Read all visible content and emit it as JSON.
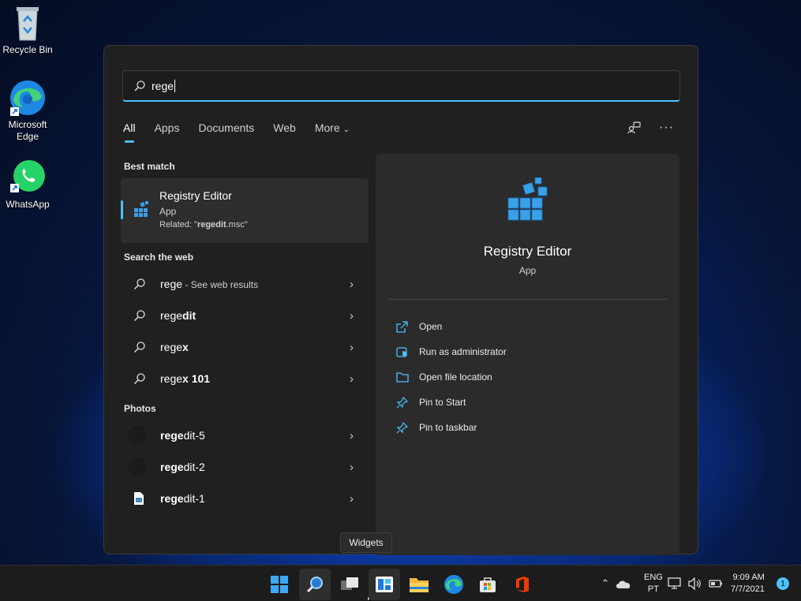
{
  "desktop": {
    "icons": [
      {
        "label": "Recycle Bin"
      },
      {
        "label": "Microsoft Edge"
      },
      {
        "label": "WhatsApp"
      }
    ]
  },
  "search": {
    "query": "rege",
    "tabs": [
      "All",
      "Apps",
      "Documents",
      "Web",
      "More"
    ],
    "active_tab": "All",
    "best_match": {
      "heading": "Best match",
      "title": "Registry Editor",
      "subtitle": "App",
      "related_prefix": "Related: \"",
      "related_bold": "regedit",
      "related_suffix": ".msc\""
    },
    "web": {
      "heading": "Search the web",
      "items": [
        {
          "bold": "rege",
          "rest": "",
          "note": " - See web results"
        },
        {
          "bold": "rege",
          "rest": "dit",
          "note": ""
        },
        {
          "bold": "rege",
          "rest": "x",
          "note": ""
        },
        {
          "bold": "rege",
          "rest": "x 101",
          "note": ""
        }
      ]
    },
    "photos": {
      "heading": "Photos",
      "items": [
        {
          "bold": "rege",
          "rest": "dit-5"
        },
        {
          "bold": "rege",
          "rest": "dit-2"
        },
        {
          "bold": "rege",
          "rest": "dit-1"
        }
      ]
    },
    "detail": {
      "name": "Registry Editor",
      "kind": "App",
      "actions": [
        "Open",
        "Run as administrator",
        "Open file location",
        "Pin to Start",
        "Pin to taskbar"
      ]
    }
  },
  "tooltip": "Widgets",
  "taskbar": {
    "lang_top": "ENG",
    "lang_bottom": "PT",
    "time": "9:09 AM",
    "date": "7/7/2021",
    "notification_count": "1"
  },
  "colors": {
    "accent": "#4cc2ff",
    "panel": "#202020",
    "detail": "#2b2b2b"
  }
}
